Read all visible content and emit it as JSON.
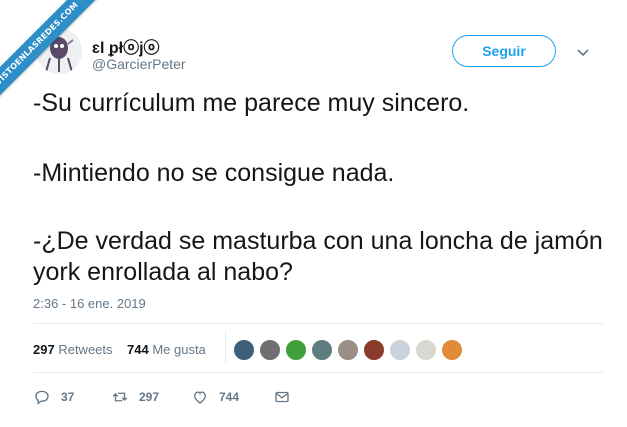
{
  "watermark": "VISTOENLASREDES.COM",
  "user": {
    "display_name": "ɛl ᵱłⓞjⓞ",
    "handle": "@GarcierPeter"
  },
  "follow_label": "Seguir",
  "tweet": {
    "lines": [
      "-Su currículum me parece muy sincero.",
      "-Mintiendo no se consigue nada.",
      "-¿De verdad se masturba con una loncha de jamón york enrollada al nabo?"
    ]
  },
  "timestamp": "2:36 - 16 ene. 2019",
  "stats": {
    "retweets_count": "297",
    "retweets_label": "Retweets",
    "likes_count": "744",
    "likes_label": "Me gusta"
  },
  "likers": [
    {
      "icon": "liker-avatar-1",
      "color": "#3d5f7a"
    },
    {
      "icon": "liker-avatar-2",
      "color": "#6f6f6f"
    },
    {
      "icon": "liker-avatar-3",
      "color": "#3fa03a"
    },
    {
      "icon": "liker-avatar-4",
      "color": "#5d7d7e"
    },
    {
      "icon": "liker-avatar-5",
      "color": "#9a8e86"
    },
    {
      "icon": "liker-avatar-6",
      "color": "#8a3b2c"
    },
    {
      "icon": "liker-avatar-7",
      "color": "#c9d2dc"
    },
    {
      "icon": "liker-avatar-8",
      "color": "#d8d8d0"
    },
    {
      "icon": "liker-avatar-9",
      "color": "#e08a3a"
    }
  ],
  "actions": {
    "replies": "37",
    "retweets": "297",
    "likes": "744"
  },
  "colors": {
    "accent": "#1da1f2",
    "muted": "#657786",
    "text": "#14171a",
    "watermark_bg": "#2e8ec8"
  }
}
